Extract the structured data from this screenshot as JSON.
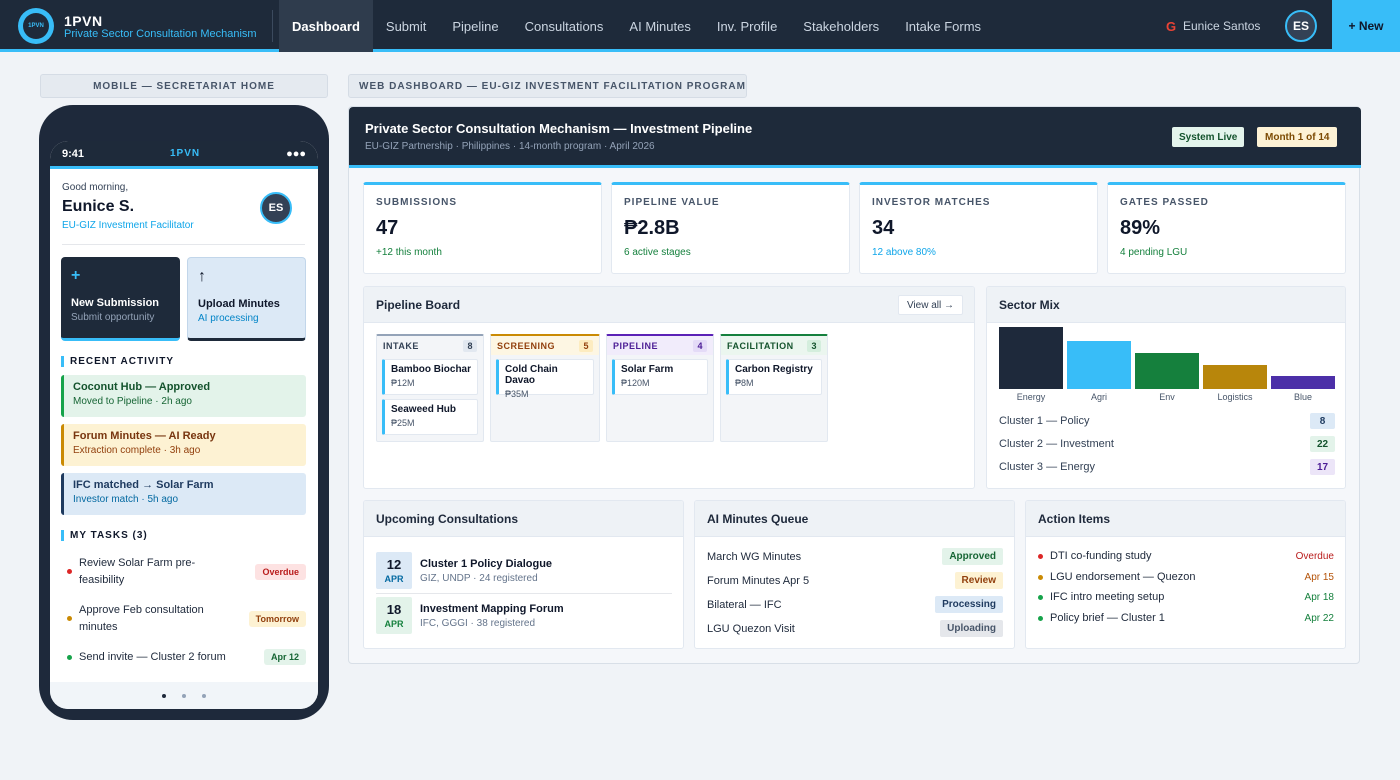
{
  "topbar": {
    "logo_text": "1PVN",
    "brand_name": "1PVN",
    "brand_sub": "Private Sector Consultation Mechanism",
    "nav": [
      {
        "label": "Dashboard",
        "active": true
      },
      {
        "label": "Submit"
      },
      {
        "label": "Pipeline"
      },
      {
        "label": "Consultations"
      },
      {
        "label": "AI Minutes"
      },
      {
        "label": "Inv. Profile"
      },
      {
        "label": "Stakeholders"
      },
      {
        "label": "Intake Forms"
      }
    ],
    "google_mark": "G",
    "user_name": "Eunice Santos",
    "user_initials": "ES",
    "new_label": "+ New"
  },
  "labels": {
    "mobile": "MOBILE — SECRETARIAT HOME",
    "web": "WEB DASHBOARD — EU-GIZ INVESTMENT FACILITATION PROGRAM"
  },
  "mobile": {
    "time": "9:41",
    "app": "1PVN",
    "signal": "●●●",
    "greeting": "Good morning,",
    "name": "Eunice S.",
    "role": "EU-GIZ Investment Facilitator",
    "initials": "ES",
    "quick_actions": [
      {
        "icon": "+",
        "title": "New Submission",
        "sub": "Submit opportunity"
      },
      {
        "icon": "↑",
        "title": "Upload Minutes",
        "sub": "AI processing"
      }
    ],
    "recent_heading": "RECENT ACTIVITY",
    "activity": [
      {
        "title": "Coconut Hub — Approved",
        "sub": "Moved to Pipeline · 2h ago"
      },
      {
        "title": "Forum Minutes — AI Ready",
        "sub": "Extraction complete · 3h ago"
      },
      {
        "title": "IFC matched → Solar Farm",
        "sub": "Investor match · 5h ago"
      }
    ],
    "tasks_heading": "MY TASKS (3)",
    "tasks": [
      {
        "text": "Review Solar Farm pre-feasibility",
        "badge": "Overdue"
      },
      {
        "text": "Approve Feb consultation minutes",
        "badge": "Tomorrow"
      },
      {
        "text": "Send invite — Cluster 2 forum",
        "badge": "Apr 12"
      }
    ]
  },
  "web": {
    "title": "Private Sector Consultation Mechanism — Investment Pipeline",
    "subtitle": "EU-GIZ Partnership · Philippines · 14-month program · April 2026",
    "badge_live": "System Live",
    "badge_month": "Month 1 of 14",
    "kpis": [
      {
        "label": "SUBMISSIONS",
        "value": "47",
        "sub": "+12 this month"
      },
      {
        "label": "PIPELINE VALUE",
        "value": "₱2.8B",
        "sub": "6 active stages"
      },
      {
        "label": "INVESTOR MATCHES",
        "value": "34",
        "sub": "12 above 80%"
      },
      {
        "label": "GATES PASSED",
        "value": "89%",
        "sub": "4 pending LGU"
      }
    ],
    "pipeline": {
      "title": "Pipeline Board",
      "view_all": "View all →",
      "columns": [
        {
          "name": "INTAKE",
          "count": "8",
          "cards": [
            {
              "title": "Bamboo Biochar",
              "value": "₱12M"
            },
            {
              "title": "Seaweed Hub",
              "value": "₱25M"
            }
          ]
        },
        {
          "name": "SCREENING",
          "count": "5",
          "cards": [
            {
              "title": "Cold Chain Davao",
              "value": "₱35M"
            }
          ]
        },
        {
          "name": "PIPELINE",
          "count": "4",
          "cards": [
            {
              "title": "Solar Farm",
              "value": "₱120M"
            }
          ]
        },
        {
          "name": "FACILITATION",
          "count": "3",
          "cards": [
            {
              "title": "Carbon Registry",
              "value": "₱8M"
            }
          ]
        }
      ]
    },
    "sector": {
      "title": "Sector Mix",
      "clusters": [
        {
          "label": "Cluster 1 — Policy",
          "count": "8"
        },
        {
          "label": "Cluster 2 — Investment",
          "count": "22"
        },
        {
          "label": "Cluster 3 — Energy",
          "count": "17"
        }
      ]
    },
    "consultations": {
      "title": "Upcoming Consultations",
      "items": [
        {
          "day": "12",
          "month": "APR",
          "title": "Cluster 1 Policy Dialogue",
          "sub": "GIZ, UNDP · 24 registered"
        },
        {
          "day": "18",
          "month": "APR",
          "title": "Investment Mapping Forum",
          "sub": "IFC, GGGI · 38 registered"
        }
      ]
    },
    "minutes": {
      "title": "AI Minutes Queue",
      "items": [
        {
          "name": "March WG Minutes",
          "status": "Approved"
        },
        {
          "name": "Forum Minutes Apr 5",
          "status": "Review"
        },
        {
          "name": "Bilateral — IFC",
          "status": "Processing"
        },
        {
          "name": "LGU Quezon Visit",
          "status": "Uploading"
        }
      ]
    },
    "actions": {
      "title": "Action Items",
      "items": [
        {
          "text": "DTI co-funding study",
          "due": "Overdue"
        },
        {
          "text": "LGU endorsement — Quezon",
          "due": "Apr 15"
        },
        {
          "text": "IFC intro meeting setup",
          "due": "Apr 18"
        },
        {
          "text": "Policy brief — Cluster 1",
          "due": "Apr 22"
        }
      ]
    }
  },
  "chart_data": {
    "type": "bar",
    "categories": [
      "Energy",
      "Agri",
      "Env",
      "Logistics",
      "Blue"
    ],
    "values": [
      62,
      48,
      36,
      24,
      13
    ],
    "colors": [
      "#1e293b",
      "#38bdf8",
      "#15803d",
      "#b8860b",
      "#4c2fa8"
    ],
    "ylim": [
      0,
      62
    ]
  },
  "colors": {
    "accent": "#38bdf8",
    "navy": "#1e2a3a"
  }
}
